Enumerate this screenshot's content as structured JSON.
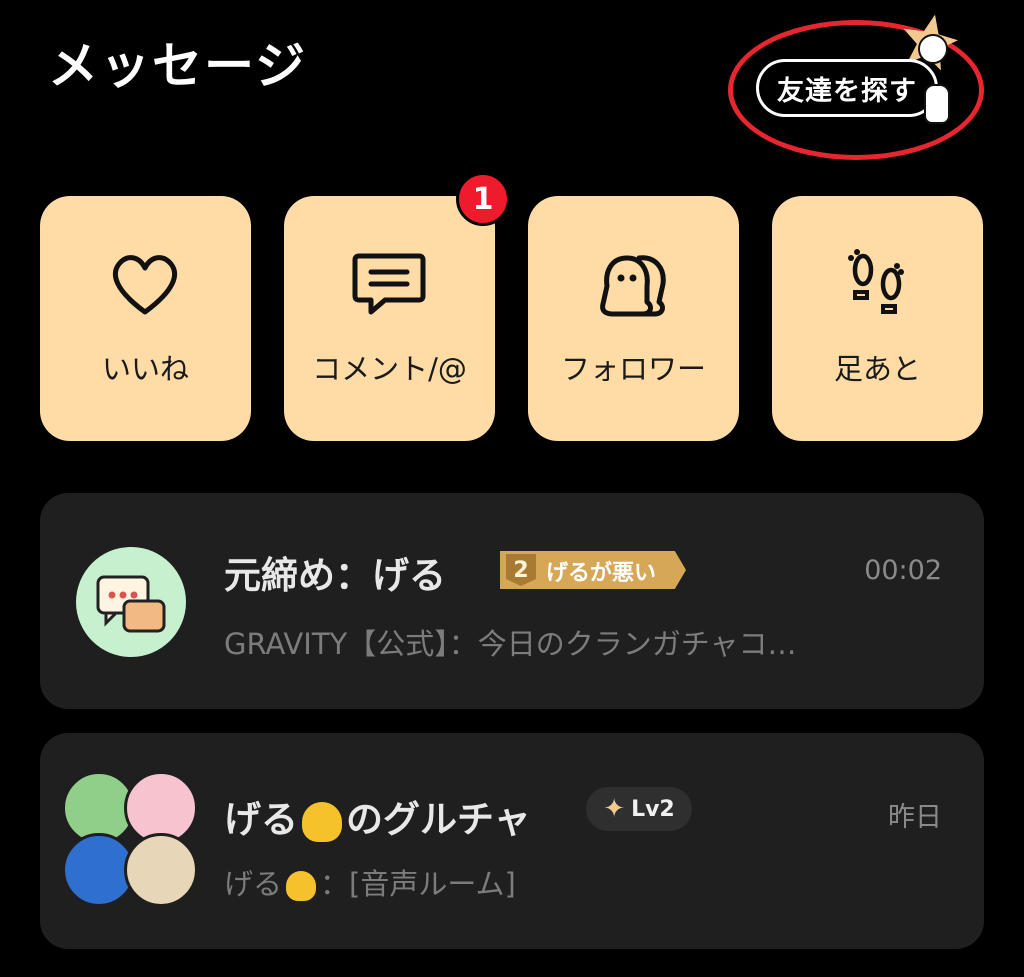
{
  "header": {
    "title": "メッセージ",
    "find_friends_label": "友達を探す"
  },
  "categories": [
    {
      "label": "いいね",
      "icon": "heart-icon"
    },
    {
      "label": "コメント/@",
      "icon": "comment-icon",
      "badge": "1"
    },
    {
      "label": "フォロワー",
      "icon": "followers-icon"
    },
    {
      "label": "足あと",
      "icon": "footprints-icon"
    }
  ],
  "chats": [
    {
      "name": "元締め：げる",
      "rank_number": "2",
      "rank_text": "げるが悪い",
      "time": "00:02",
      "preview": "GRAVITY【公式】：今日のクランガチャコ…"
    },
    {
      "name_prefix": "げる",
      "name_suffix": "のグルチャ",
      "level": "Lv2",
      "time": "昨日",
      "preview_prefix": "げる",
      "preview_suffix": "：[音声ルーム]"
    }
  ],
  "colors": {
    "background": "#000000",
    "card": "#ffdca6",
    "row": "#1f1f1f",
    "badge_red": "#ee1b2d",
    "highlight_ring": "#e8262f",
    "rank_gold": "#d7a758"
  }
}
